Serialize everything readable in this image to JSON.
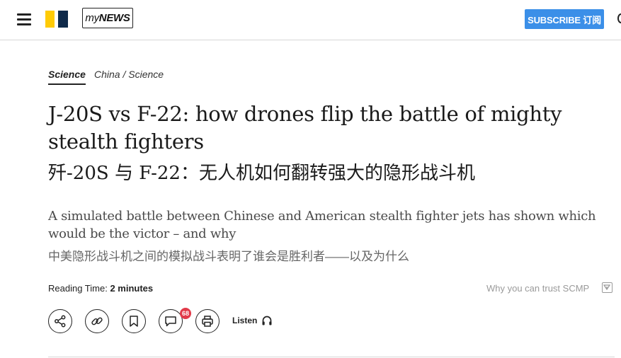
{
  "header": {
    "logo_name": "scmp-logo",
    "mynews_prefix": "my",
    "mynews_suffix": "NEWS",
    "subscribe_label": "SUBSCRIBE 订阅",
    "colors": {
      "accent": "#3b8fe8",
      "logo_yellow": "#ffcb05",
      "logo_navy": "#0f2a4a"
    }
  },
  "article": {
    "section": "Science",
    "breadcrumb": "China / Science",
    "title_en": "J-20S vs F-22: how drones flip the battle of mighty stealth fighters",
    "title_cn": "歼-20S 与 F-22：无人机如何翻转强大的隐形战斗机",
    "summary_en": "A simulated battle between Chinese and American stealth fighter jets has shown which would be the victor – and why",
    "summary_cn": "中美隐形战斗机之间的模拟战斗表明了谁会是胜利者——以及为什么",
    "reading_time_label": "Reading Time:",
    "reading_time_value": "2 minutes",
    "trust_link": "Why you can trust SCMP"
  },
  "actions": {
    "icons": [
      "share-icon",
      "link-icon",
      "bookmark-icon",
      "comment-icon",
      "print-icon"
    ],
    "comment_count": "68",
    "listen_label": "Listen",
    "badge_color": "#e23b4a"
  }
}
